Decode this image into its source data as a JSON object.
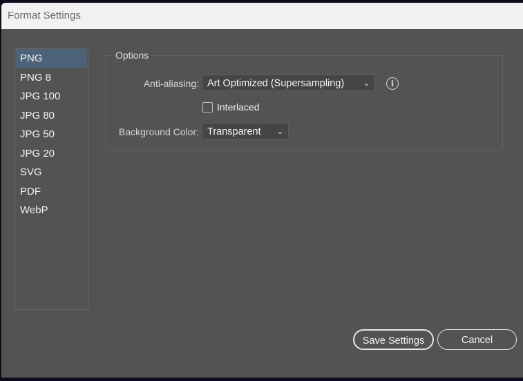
{
  "window": {
    "title": "Format Settings"
  },
  "formats": {
    "items": [
      "PNG",
      "PNG 8",
      "JPG 100",
      "JPG 80",
      "JPG 50",
      "JPG 20",
      "SVG",
      "PDF",
      "WebP"
    ],
    "selected": "PNG"
  },
  "options": {
    "group_label": "Options",
    "anti_aliasing_label": "Anti-aliasing:",
    "anti_aliasing_value": "Art Optimized (Supersampling)",
    "interlaced_label": "Interlaced",
    "interlaced_checked": false,
    "background_label": "Background Color:",
    "background_value": "Transparent"
  },
  "buttons": {
    "save": "Save Settings",
    "cancel": "Cancel"
  },
  "colors": {
    "selection": "#4b6279",
    "panel": "#535353"
  }
}
